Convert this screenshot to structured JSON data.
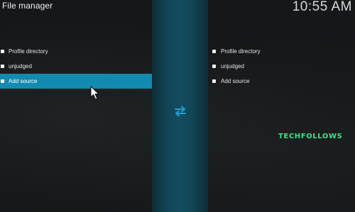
{
  "header": {
    "title": "File manager",
    "clock": "10:55 AM"
  },
  "left_pane": {
    "items": [
      {
        "label": "Profile directory",
        "selected": false
      },
      {
        "label": "unjudged",
        "selected": false
      },
      {
        "label": "Add source",
        "selected": true
      }
    ]
  },
  "right_pane": {
    "items": [
      {
        "label": "Profile directory"
      },
      {
        "label": "unjudged"
      },
      {
        "label": "Add source"
      }
    ]
  },
  "center": {
    "icon": "swap-arrows-icon"
  },
  "watermark": {
    "text": "TECHFOLLOWS",
    "color": "#3fe08a"
  },
  "colors": {
    "accent": "#138ab0",
    "divider": "#134c5f",
    "background": "#151718"
  }
}
